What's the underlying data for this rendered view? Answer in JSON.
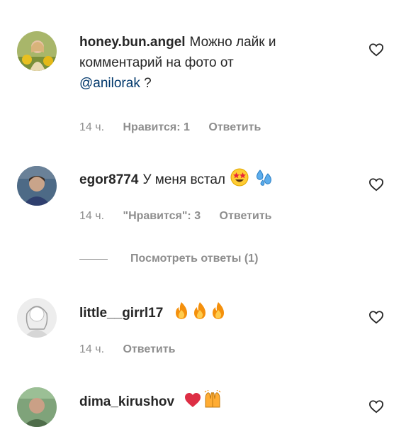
{
  "comments": [
    {
      "username": "honey.bun.angel",
      "text_line1": "Можно лайк и",
      "text_line2": "комментарий на фото от",
      "mention": "@anilorak",
      "text_after_mention": " ?",
      "time": "14 ч.",
      "likes": "Нравится: 1",
      "reply": "Ответить"
    },
    {
      "username": "egor8774",
      "text": "У меня встал",
      "emojis": [
        "star-struck-emoji",
        "sweat-droplets-emoji"
      ],
      "time": "14 ч.",
      "likes": "\"Нравится\": 3",
      "reply": "Ответить",
      "view_replies": "Посмотреть ответы (1)"
    },
    {
      "username": "little__girrl17",
      "emojis": [
        "fire-emoji",
        "fire-emoji",
        "fire-emoji"
      ],
      "time": "14 ч.",
      "reply": "Ответить"
    },
    {
      "username": "dima_kirushov",
      "emojis": [
        "red-heart-emoji",
        "raising-hands-emoji"
      ]
    }
  ],
  "colors": {
    "text": "#262626",
    "muted": "#8e8e8e",
    "mention": "#00376b",
    "fire": "#f4900c",
    "heart_emoji": "#dd2e44"
  },
  "icons": [
    "heart-outline-icon"
  ]
}
